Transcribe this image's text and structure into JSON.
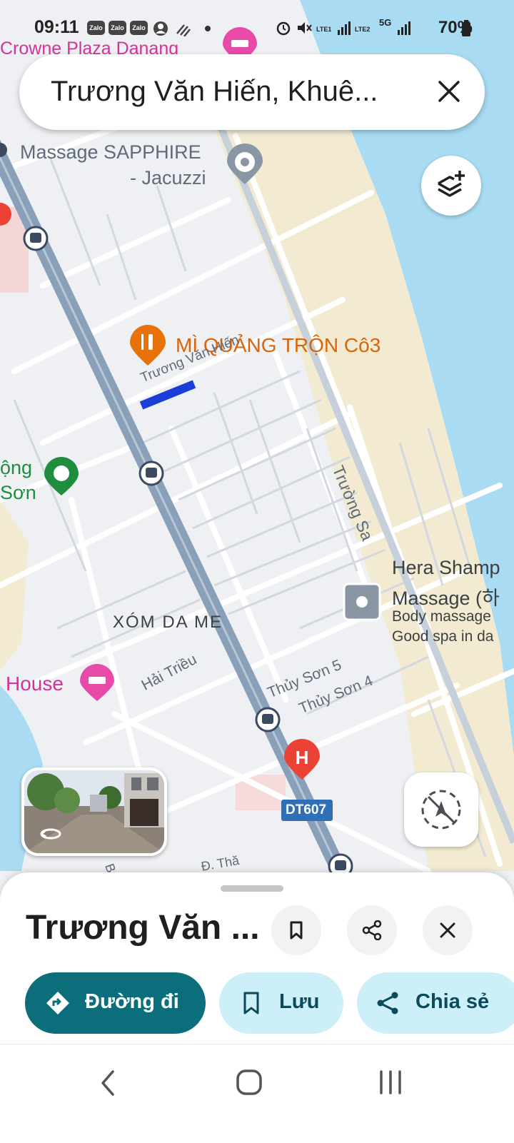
{
  "status_bar": {
    "time": "09:11",
    "notification_icons": [
      "Zalo",
      "Zalo",
      "Zalo"
    ],
    "lte1": "LTE1",
    "lte2": "LTE2",
    "network": "5G",
    "battery": "70%"
  },
  "search": {
    "query": "Trương Văn Hiến, Khuê..."
  },
  "map": {
    "places": {
      "crowne": "Crowne Plaza Danang",
      "massage_line1": "Massage SAPPHIRE",
      "massage_line2": "- Jacuzzi",
      "restaurant": "MÌ QUẢNG TRỘN Cô3",
      "dong_son_1": "ộng",
      "dong_son_2": "Sơn",
      "hera_1": "Hera Shamp",
      "hera_2": "Massage (하",
      "hera_3": "Body massage",
      "hera_4": "Good spa in da",
      "neighborhood": "XÓM DA ME",
      "house": "House"
    },
    "streets": {
      "truong_van_hien": "Trương Văn Hiến",
      "truong_sa": "Trường Sa",
      "hai_trieu": "Hải Triều",
      "thuy_son_5": "Thủy Sơn 5",
      "thuy_son_4": "Thủy Sơn 4",
      "dt607": "DT607",
      "bui": "Bùi",
      "d_tha": "Đ. Thă"
    },
    "colors": {
      "water": "#a9dcf3",
      "sand": "#f2ebd2",
      "land": "#eef0f3",
      "road": "#ffffff",
      "highway": "#8a9fb8",
      "restaurant_pin": "#e8710a",
      "hotel_pin": "#e84aa8",
      "hospital_pin": "#ea4335"
    }
  },
  "place_sheet": {
    "title": "Trương Văn ...",
    "actions": {
      "directions": "Đường đi",
      "save": "Lưu",
      "share": "Chia sẻ"
    },
    "accent_color": "#0b6e7a"
  }
}
